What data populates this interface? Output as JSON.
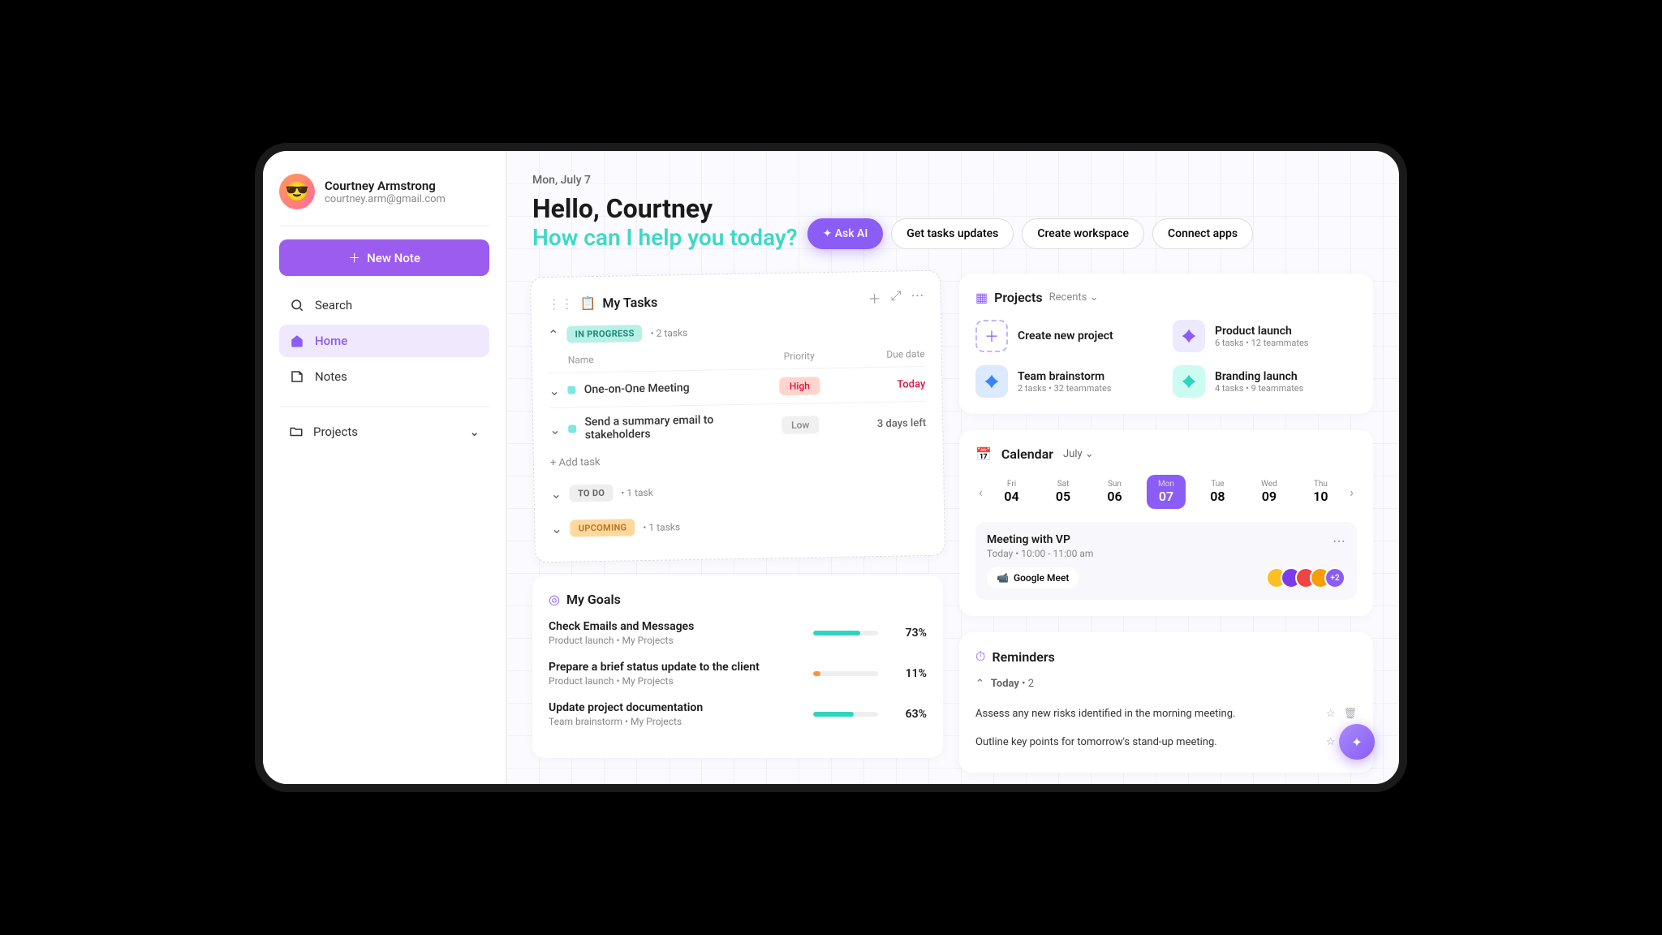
{
  "user": {
    "name": "Courtney Armstrong",
    "email": "courtney.arm@gmail.com"
  },
  "sidebar": {
    "newNote": "New Note",
    "items": [
      "Search",
      "Home",
      "Notes"
    ],
    "projects": "Projects"
  },
  "header": {
    "date": "Mon, July 7",
    "greeting": "Hello, Courtney",
    "subtitle": "How can I help you today?",
    "chips": [
      "✦ Ask AI",
      "Get tasks updates",
      "Create workspace",
      "Connect apps"
    ]
  },
  "tasks": {
    "title": "My Tasks",
    "sections": [
      {
        "label": "IN PROGRESS",
        "count": "2 tasks",
        "rows": [
          {
            "name": "One-on-One Meeting",
            "priority": "High",
            "due": "Today",
            "dueClass": "today"
          },
          {
            "name": "Send a summary email to stakeholders",
            "priority": "Low",
            "due": "3 days left",
            "dueClass": "normal"
          }
        ]
      },
      {
        "label": "TO DO",
        "count": "1 task"
      },
      {
        "label": "UPCOMING",
        "count": "1 tasks"
      }
    ],
    "columns": {
      "name": "Name",
      "priority": "Priority",
      "due": "Due date"
    },
    "addTask": "+ Add task"
  },
  "goals": {
    "title": "My Goals",
    "items": [
      {
        "name": "Check Emails and Messages",
        "meta": "Product launch  •  My Projects",
        "pct": 73,
        "color": "#2dd4bf"
      },
      {
        "name": "Prepare a brief status update to the client",
        "meta": "Product launch  •  My Projects",
        "pct": 11,
        "color": "#fb923c"
      },
      {
        "name": "Update project documentation",
        "meta": "Team brainstorm  •  My Projects",
        "pct": 63,
        "color": "#2dd4bf"
      }
    ]
  },
  "projects": {
    "title": "Projects",
    "filter": "Recents",
    "create": "Create new project",
    "items": [
      {
        "name": "Product launch",
        "sub": "6 tasks  •  12 teammates",
        "color": "#8b5cf6"
      },
      {
        "name": "Team brainstorm",
        "sub": "2 tasks  •  32 teammates",
        "color": "#3b82f6"
      },
      {
        "name": "Branding launch",
        "sub": "4 tasks  •  9 teammates",
        "color": "#2dd4bf"
      }
    ]
  },
  "calendar": {
    "title": "Calendar",
    "month": "July",
    "days": [
      {
        "dow": "Fri",
        "num": "04"
      },
      {
        "dow": "Sat",
        "num": "05"
      },
      {
        "dow": "Sun",
        "num": "06"
      },
      {
        "dow": "Mon",
        "num": "07",
        "active": true
      },
      {
        "dow": "Tue",
        "num": "08"
      },
      {
        "dow": "Wed",
        "num": "09"
      },
      {
        "dow": "Thu",
        "num": "10"
      }
    ],
    "event": {
      "title": "Meeting with VP",
      "time": "Today  •  10:00 - 11:00 am",
      "app": "Google Meet",
      "more": "+2"
    }
  },
  "reminders": {
    "title": "Reminders",
    "section": "Today",
    "count": "2",
    "items": [
      "Assess any new risks identified in the morning meeting.",
      "Outline key points for tomorrow's stand-up meeting."
    ]
  }
}
